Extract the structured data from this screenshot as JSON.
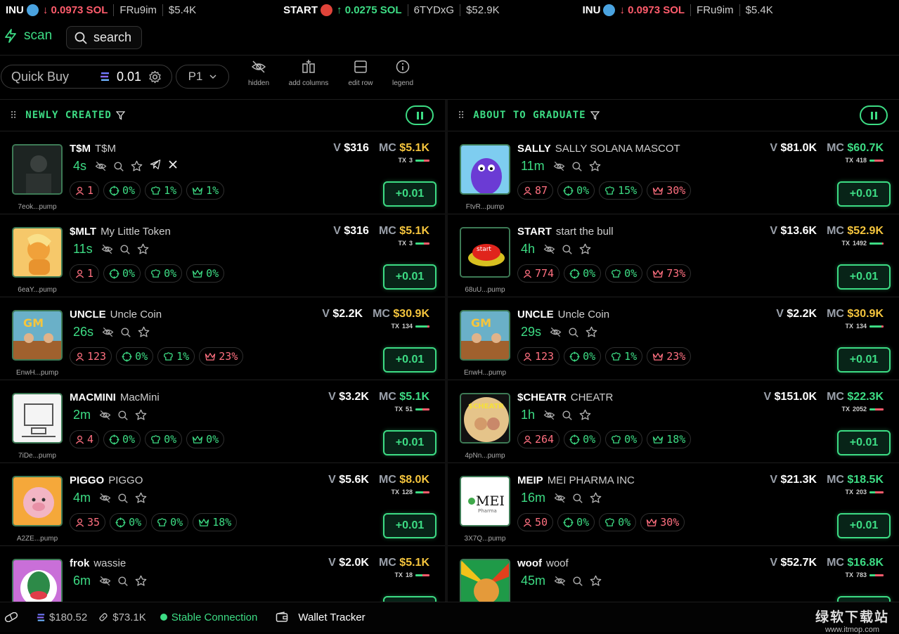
{
  "ticker": [
    {
      "symbol": "INU",
      "direction": "down",
      "change": "0.0973 SOL",
      "address": "FRu9im",
      "mc": "$5.4K",
      "icon_color": "#4aa3e0"
    },
    {
      "symbol": "START",
      "direction": "up",
      "change": "0.0275 SOL",
      "address": "6TYDxG",
      "mc": "$52.9K",
      "icon_color": "#e0443a"
    },
    {
      "symbol": "INU",
      "direction": "down",
      "change": "0.0973 SOL",
      "address": "FRu9im",
      "mc": "$5.4K",
      "icon_color": "#4aa3e0"
    }
  ],
  "topbar": {
    "scan_label": "scan",
    "search_label": "search"
  },
  "toolbar": {
    "quick_buy_label": "Quick Buy",
    "quick_buy_amount": "0.01",
    "preset": "P1",
    "tools": [
      {
        "label": "hidden",
        "icon": "eye-off-icon"
      },
      {
        "label": "add columns",
        "icon": "columns-icon"
      },
      {
        "label": "edit row",
        "icon": "rows-icon"
      },
      {
        "label": "legend",
        "icon": "info-icon"
      }
    ]
  },
  "columns": {
    "left": {
      "title": "NEWLY CREATED",
      "rows": [
        {
          "ticker": "T$M",
          "name": "T$M",
          "age": "4s",
          "addr": "7eok...pump",
          "holders": "1",
          "c1": "0%",
          "c2": "1%",
          "c3": "1%",
          "c3_red": false,
          "v": "$316",
          "mc": "$5.1K",
          "mc_green": false,
          "tx": "3",
          "buy_ratio": 0.6,
          "socials": true,
          "img": "dark"
        },
        {
          "ticker": "$MLT",
          "name": "My Little Token",
          "age": "11s",
          "addr": "6eaY...pump",
          "holders": "1",
          "c1": "0%",
          "c2": "0%",
          "c3": "0%",
          "c3_red": false,
          "v": "$316",
          "mc": "$5.1K",
          "mc_green": false,
          "tx": "3",
          "buy_ratio": 0.6,
          "socials": false,
          "img": "pony"
        },
        {
          "ticker": "UNCLE",
          "name": "Uncle Coin",
          "age": "26s",
          "addr": "EnwH...pump",
          "holders": "123",
          "c1": "0%",
          "c2": "1%",
          "c3": "23%",
          "c3_red": true,
          "v": "$2.2K",
          "mc": "$30.9K",
          "mc_green": false,
          "tx": "134",
          "buy_ratio": 0.85,
          "socials": false,
          "img": "gm"
        },
        {
          "ticker": "MACMINI",
          "name": "MacMini",
          "age": "2m",
          "addr": "7iDe...pump",
          "holders": "4",
          "c1": "0%",
          "c2": "0%",
          "c3": "0%",
          "c3_red": false,
          "v": "$3.2K",
          "mc": "$5.1K",
          "mc_green": true,
          "tx": "51",
          "buy_ratio": 0.5,
          "socials": false,
          "img": "mac"
        },
        {
          "ticker": "PIGGO",
          "name": "PIGGO",
          "age": "4m",
          "addr": "A2ZE...pump",
          "holders": "35",
          "c1": "0%",
          "c2": "0%",
          "c3": "18%",
          "c3_red": false,
          "v": "$5.6K",
          "mc": "$8.0K",
          "mc_green": false,
          "tx": "128",
          "buy_ratio": 0.55,
          "socials": false,
          "img": "pig"
        },
        {
          "ticker": "frok",
          "name": "wassie",
          "age": "6m",
          "addr": "",
          "holders": "",
          "c1": "",
          "c2": "",
          "c3": "",
          "c3_red": false,
          "v": "$2.0K",
          "mc": "$5.1K",
          "mc_green": false,
          "tx": "18",
          "buy_ratio": 0.5,
          "socials": false,
          "img": "duck"
        }
      ]
    },
    "right": {
      "title": "ABOUT TO GRADUATE",
      "rows": [
        {
          "ticker": "SALLY",
          "name": "SALLY SOLANA MASCOT",
          "age": "11m",
          "addr": "FtvR...pump",
          "holders": "87",
          "c1": "0%",
          "c2": "15%",
          "c3": "30%",
          "c3_red": true,
          "v": "$81.0K",
          "mc": "$60.7K",
          "mc_green": true,
          "tx": "418",
          "buy_ratio": 0.35,
          "socials": false,
          "img": "sally"
        },
        {
          "ticker": "START",
          "name": "start the bull",
          "age": "4h",
          "addr": "68uU...pump",
          "holders": "774",
          "c1": "0%",
          "c2": "0%",
          "c3": "73%",
          "c3_red": true,
          "v": "$13.6K",
          "mc": "$52.9K",
          "mc_green": false,
          "tx": "1492",
          "buy_ratio": 0.9,
          "socials": false,
          "img": "start"
        },
        {
          "ticker": "UNCLE",
          "name": "Uncle Coin",
          "age": "29s",
          "addr": "EnwH...pump",
          "holders": "123",
          "c1": "0%",
          "c2": "1%",
          "c3": "23%",
          "c3_red": true,
          "v": "$2.2K",
          "mc": "$30.9K",
          "mc_green": false,
          "tx": "134",
          "buy_ratio": 0.85,
          "socials": false,
          "img": "gm"
        },
        {
          "ticker": "$CHEATR",
          "name": "CHEATR",
          "age": "1h",
          "addr": "4pNn...pump",
          "holders": "264",
          "c1": "0%",
          "c2": "0%",
          "c3": "18%",
          "c3_red": false,
          "v": "$151.0K",
          "mc": "$22.3K",
          "mc_green": true,
          "tx": "2052",
          "buy_ratio": 0.4,
          "socials": false,
          "img": "cheatr"
        },
        {
          "ticker": "MEIP",
          "name": "MEI PHARMA INC",
          "age": "16m",
          "addr": "3X7Q...pump",
          "holders": "50",
          "c1": "0%",
          "c2": "0%",
          "c3": "30%",
          "c3_red": true,
          "v": "$21.3K",
          "mc": "$18.5K",
          "mc_green": true,
          "tx": "203",
          "buy_ratio": 0.4,
          "socials": false,
          "img": "mei"
        },
        {
          "ticker": "woof",
          "name": "woof",
          "age": "45m",
          "addr": "",
          "holders": "",
          "c1": "",
          "c2": "",
          "c3": "",
          "c3_red": false,
          "v": "$52.7K",
          "mc": "$16.8K",
          "mc_green": true,
          "tx": "783",
          "buy_ratio": 0.4,
          "socials": false,
          "img": "dog"
        }
      ]
    }
  },
  "buy_label": "+0.01",
  "footer": {
    "sol_price": "$180.52",
    "link_value": "$73.1K",
    "connection": "Stable Connection",
    "wallet_tracker": "Wallet Tracker",
    "watermark_title": "绿软下载站",
    "watermark_url": "www.itmop.com"
  },
  "colors": {
    "accent": "#3ddc84",
    "down": "#ff5c6c",
    "mc_yellow": "#f5c53d"
  }
}
